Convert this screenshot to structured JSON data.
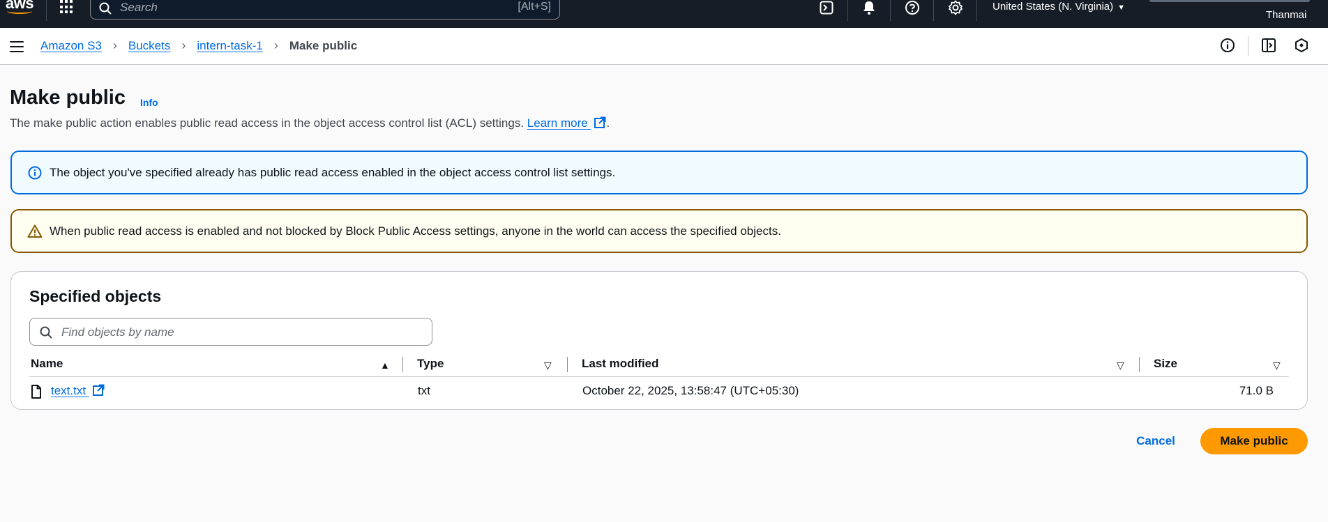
{
  "topnav": {
    "logo_text": "aws",
    "search_placeholder": "Search",
    "search_shortcut": "[Alt+S]",
    "region": "United States (N. Virginia)",
    "username": "Thanmai",
    "icons": [
      "apps-grid-icon",
      "cloudshell-icon",
      "bell-icon",
      "help-icon",
      "gear-icon"
    ]
  },
  "breadcrumb": {
    "items": [
      "Amazon S3",
      "Buckets",
      "intern-task-1"
    ],
    "current": "Make public"
  },
  "header": {
    "title": "Make public",
    "info_label": "Info",
    "description": "The make public action enables public read access in the object access control list (ACL) settings.",
    "learn_more": "Learn more",
    "description_end": "."
  },
  "alerts": {
    "info": "The object you've specified already has public read access enabled in the object access control list settings.",
    "warning": "When public read access is enabled and not blocked by Block Public Access settings, anyone in the world can access the specified objects."
  },
  "objects_panel": {
    "title": "Specified objects",
    "filter_placeholder": "Find objects by name",
    "columns": [
      "Name",
      "Type",
      "Last modified",
      "Size"
    ],
    "rows": [
      {
        "name": "text.txt",
        "type": "txt",
        "last_modified": "October 22, 2025, 13:58:47 (UTC+05:30)",
        "size": "71.0 B"
      }
    ]
  },
  "actions": {
    "cancel": "Cancel",
    "submit": "Make public"
  },
  "colors": {
    "nav_bg": "#161d26",
    "link": "#006ce0",
    "primary_button": "#ff9900",
    "info_border": "#006ce0",
    "warning_border": "#855900"
  }
}
